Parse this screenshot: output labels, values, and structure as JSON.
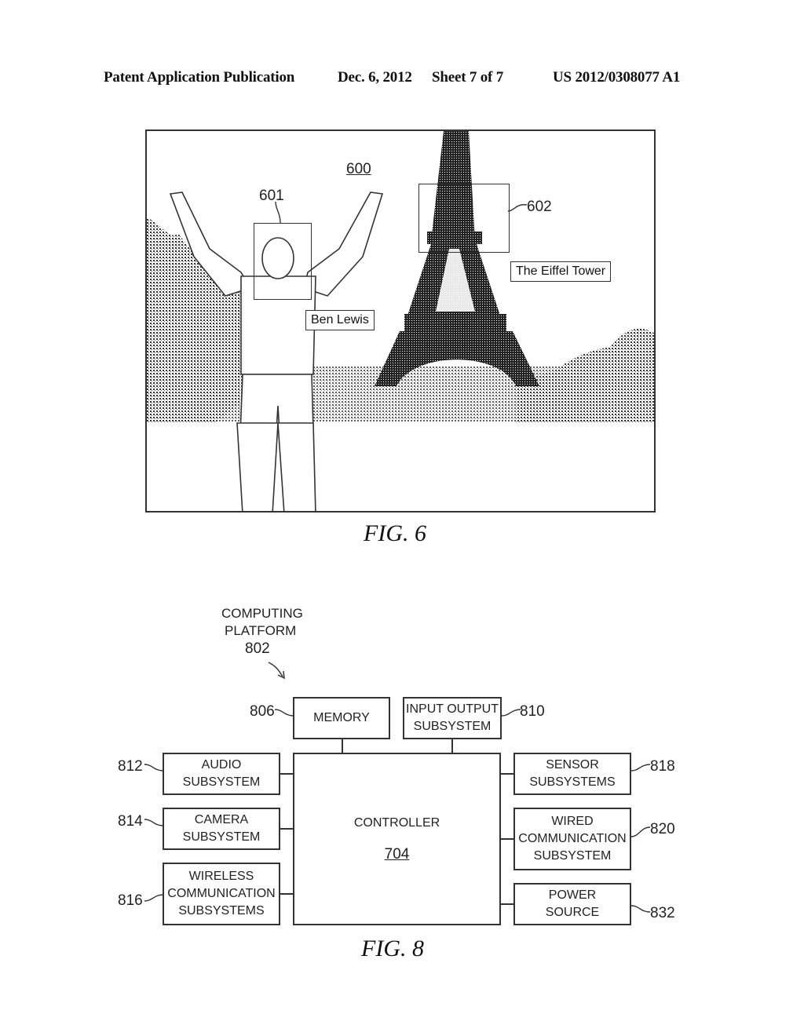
{
  "header": {
    "publication": "Patent Application Publication",
    "date": "Dec. 6, 2012",
    "sheet": "Sheet 7 of 7",
    "number": "US 2012/0308077 A1"
  },
  "fig6": {
    "caption": "FIG. 6",
    "image_ref": "600",
    "face_region_ref": "601",
    "landmark_region_ref": "602",
    "person_tag": "Ben Lewis",
    "landmark_tag": "The Eiffel Tower",
    "scene_description": "Man with raised arms in front of the Eiffel Tower with trees and crowd"
  },
  "fig8": {
    "caption": "FIG. 8",
    "platform": {
      "label_line1": "COMPUTING",
      "label_line2": "PLATFORM",
      "ref": "802"
    },
    "controller": {
      "label": "CONTROLLER",
      "ref": "704"
    },
    "top_blocks": [
      {
        "lines": [
          "MEMORY"
        ],
        "ref": "806"
      },
      {
        "lines": [
          "INPUT OUTPUT",
          "SUBSYSTEM"
        ],
        "ref": "810"
      }
    ],
    "left_blocks": [
      {
        "lines": [
          "AUDIO",
          "SUBSYSTEM"
        ],
        "ref": "812"
      },
      {
        "lines": [
          "CAMERA",
          "SUBSYSTEM"
        ],
        "ref": "814"
      },
      {
        "lines": [
          "WIRELESS",
          "COMMUNICATION",
          "SUBSYSTEMS"
        ],
        "ref": "816"
      }
    ],
    "right_blocks": [
      {
        "lines": [
          "SENSOR",
          "SUBSYSTEMS"
        ],
        "ref": "818"
      },
      {
        "lines": [
          "WIRED",
          "COMMUNICATION",
          "SUBSYSTEM"
        ],
        "ref": "820"
      },
      {
        "lines": [
          "POWER",
          "SOURCE"
        ],
        "ref": "832"
      }
    ]
  }
}
